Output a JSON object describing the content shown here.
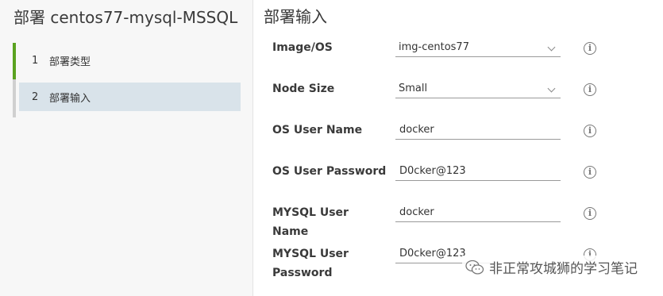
{
  "wizard": {
    "title": "部署 centos77-mysql-MSSQL",
    "steps": [
      {
        "number": "1",
        "label": "部署类型"
      },
      {
        "number": "2",
        "label": "部署输入"
      }
    ]
  },
  "form": {
    "section_title": "部署输入",
    "fields": [
      {
        "label": "Image/OS",
        "value": "img-centos77",
        "type": "select"
      },
      {
        "label": "Node Size",
        "value": "Small",
        "type": "select"
      },
      {
        "label": "OS User Name",
        "value": "docker",
        "type": "text"
      },
      {
        "label": "OS User Password",
        "value": "D0cker@123",
        "type": "text"
      },
      {
        "label": "MYSQL User Name",
        "value": "docker",
        "type": "text"
      },
      {
        "label": "MYSQL User Password",
        "value": "D0cker@123",
        "type": "text"
      }
    ],
    "info_icon_glyph": "i"
  },
  "watermark": {
    "text": "非正常攻城狮的学习笔记",
    "icon": "wechat-logo-icon"
  },
  "colors": {
    "step_done": "#5aa220",
    "step_active_bg": "#d9e3ea",
    "left_panel_bg": "#f7f7f7"
  }
}
